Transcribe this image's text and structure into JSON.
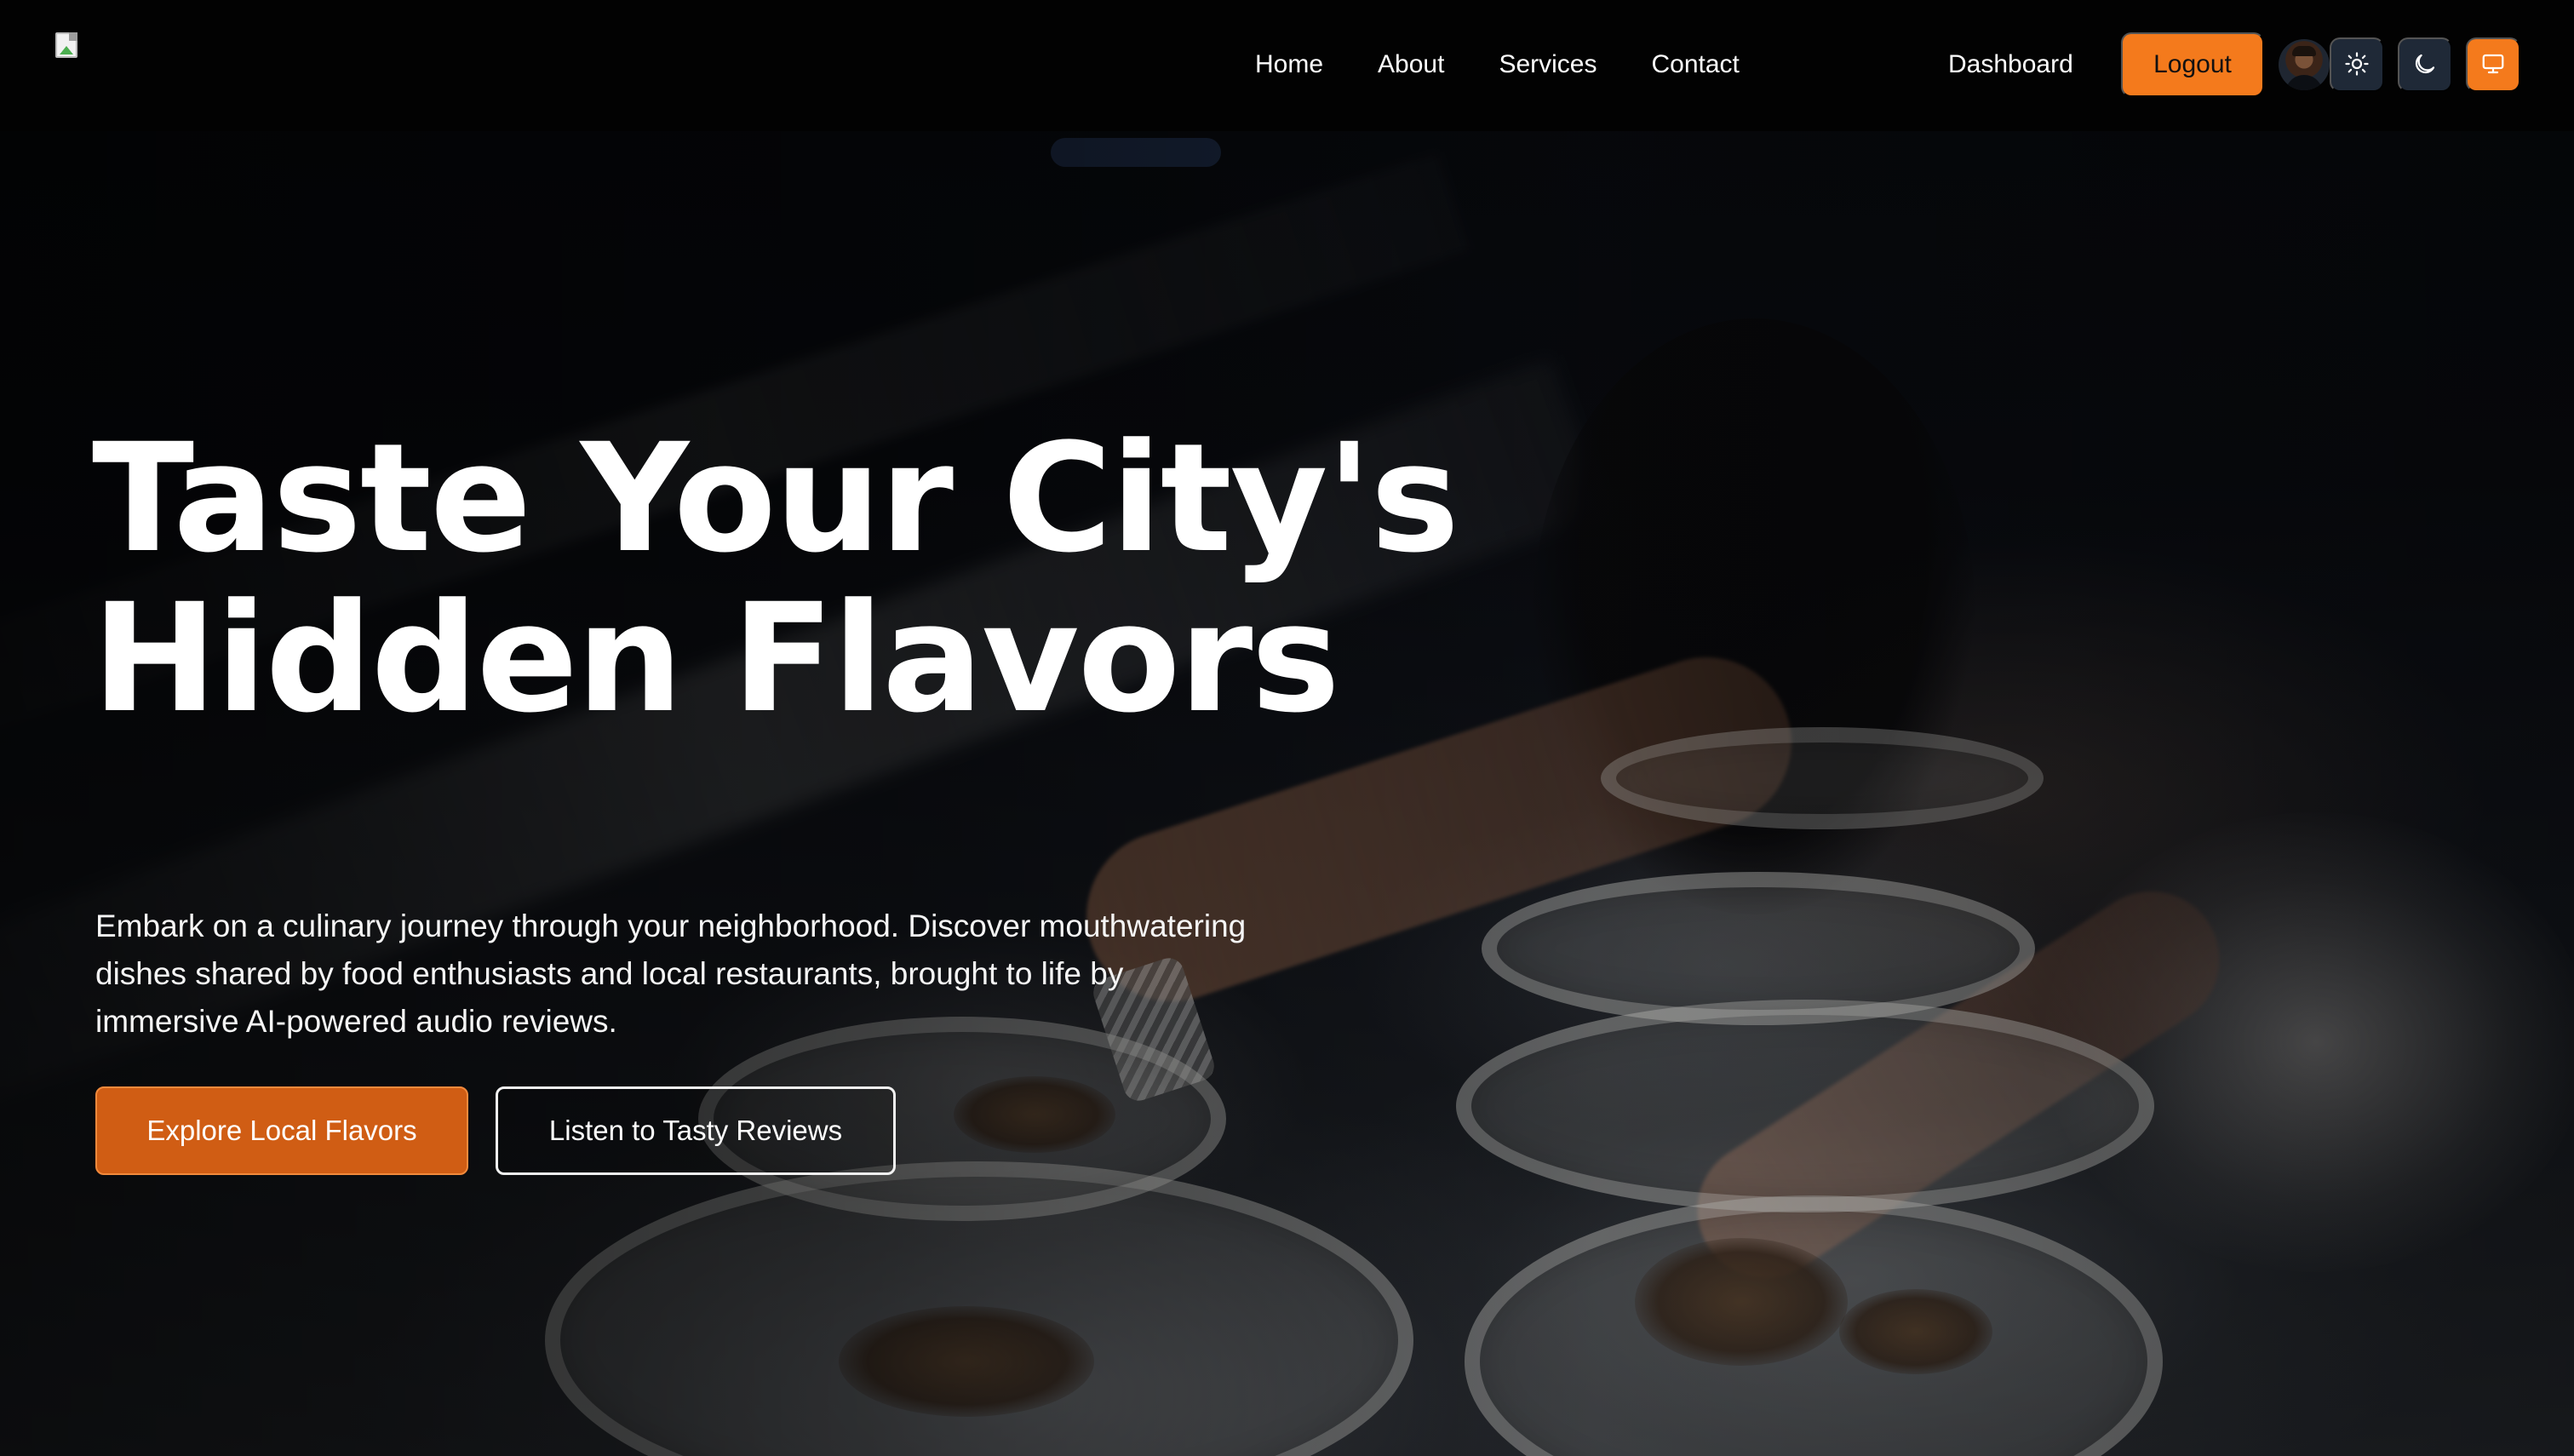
{
  "nav": {
    "links": [
      {
        "label": "Home"
      },
      {
        "label": "About"
      },
      {
        "label": "Services"
      },
      {
        "label": "Contact"
      }
    ],
    "dashboard_label": "Dashboard",
    "logout_label": "Logout",
    "icons": {
      "logo": "broken-image-icon",
      "avatar": "user-avatar",
      "light_mode": "sun-icon",
      "dark_mode": "moon-icon",
      "system_mode": "monitor-icon"
    },
    "colors": {
      "accent": "#f47a1c",
      "header_bg": "#020202",
      "icon_button_bg": "#1f2937"
    }
  },
  "hero": {
    "title_line_1": "Taste Your City's",
    "title_line_2": "Hidden Flavors",
    "description": "Embark on a culinary journey through your neighborhood. Discover mouthwatering dishes shared by food enthusiasts and local restaurants, brought to life by immersive AI-powered audio reviews.",
    "primary_cta": "Explore Local Flavors",
    "secondary_cta": "Listen to Tasty Reviews",
    "colors": {
      "primary_cta_bg": "#d05d14",
      "text": "#ffffff"
    }
  }
}
